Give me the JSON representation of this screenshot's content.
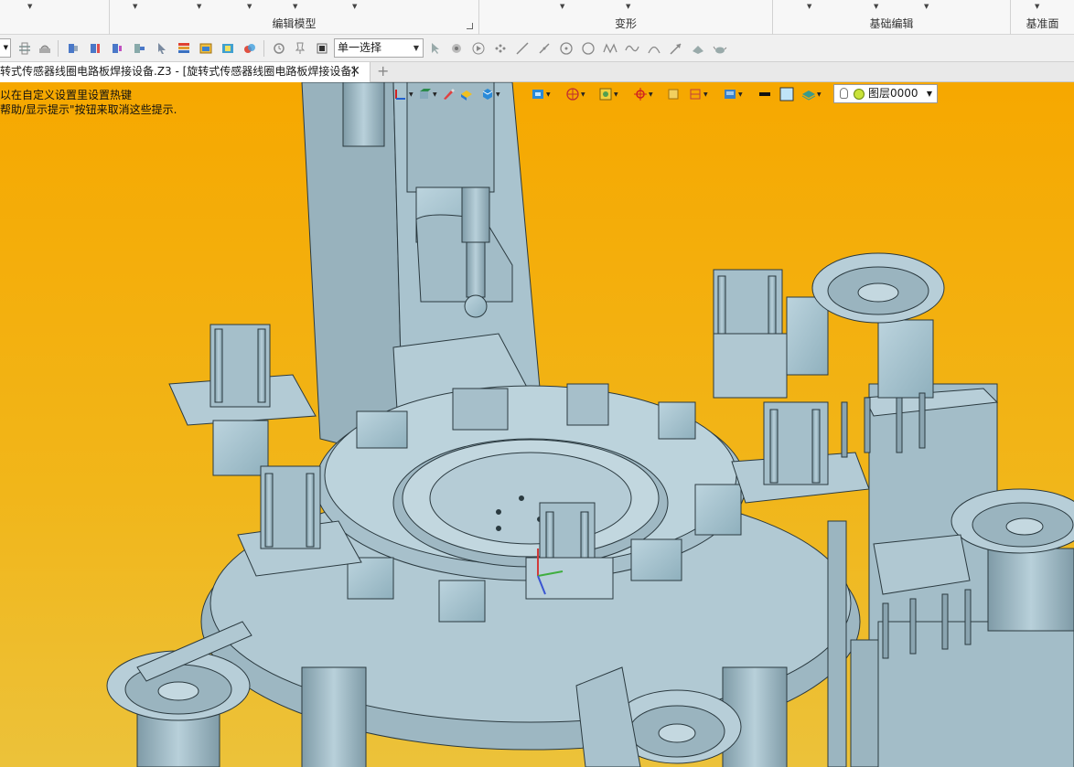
{
  "ribbon": {
    "groups": [
      {
        "label": ""
      },
      {
        "label": "编辑模型"
      },
      {
        "label": "变形"
      },
      {
        "label": "基础编辑"
      },
      {
        "label": "基准面"
      }
    ]
  },
  "toolbar": {
    "select_filter": "单一选择",
    "icons": [
      "extrude-icon",
      "boolean-icon",
      "face-icon",
      "face-offset-icon",
      "face-split-icon",
      "pick-icon",
      "list-icon",
      "window-icon",
      "layer-icon",
      "render-icon",
      "rotate-icon",
      "pin-icon",
      "stop-icon",
      "cursor-icon",
      "point-snap-icon",
      "play-icon",
      "dots-icon",
      "line-icon",
      "slash-icon",
      "circle-target-icon",
      "circle-icon",
      "wave-icon",
      "spline-icon",
      "arc-icon",
      "arrow-icon",
      "sketch-icon",
      "teapot-icon"
    ]
  },
  "tabs": {
    "document_tab": "转式传感器线圈电路板焊接设备.Z3 - [旋转式传感器线圈电路板焊接设备]",
    "close_symbol": "✕",
    "add_symbol": "+"
  },
  "viewport": {
    "hint_line1": "以在自定义设置里设置热键",
    "hint_line2": "帮助/显示提示\"按钮来取消这些提示.",
    "layer": "图层0000",
    "colors": {
      "background_top": "#f6a800",
      "background_bottom": "#ecc23a",
      "model": "#a9c4cf",
      "model_shadow": "#7d9aa6"
    }
  }
}
